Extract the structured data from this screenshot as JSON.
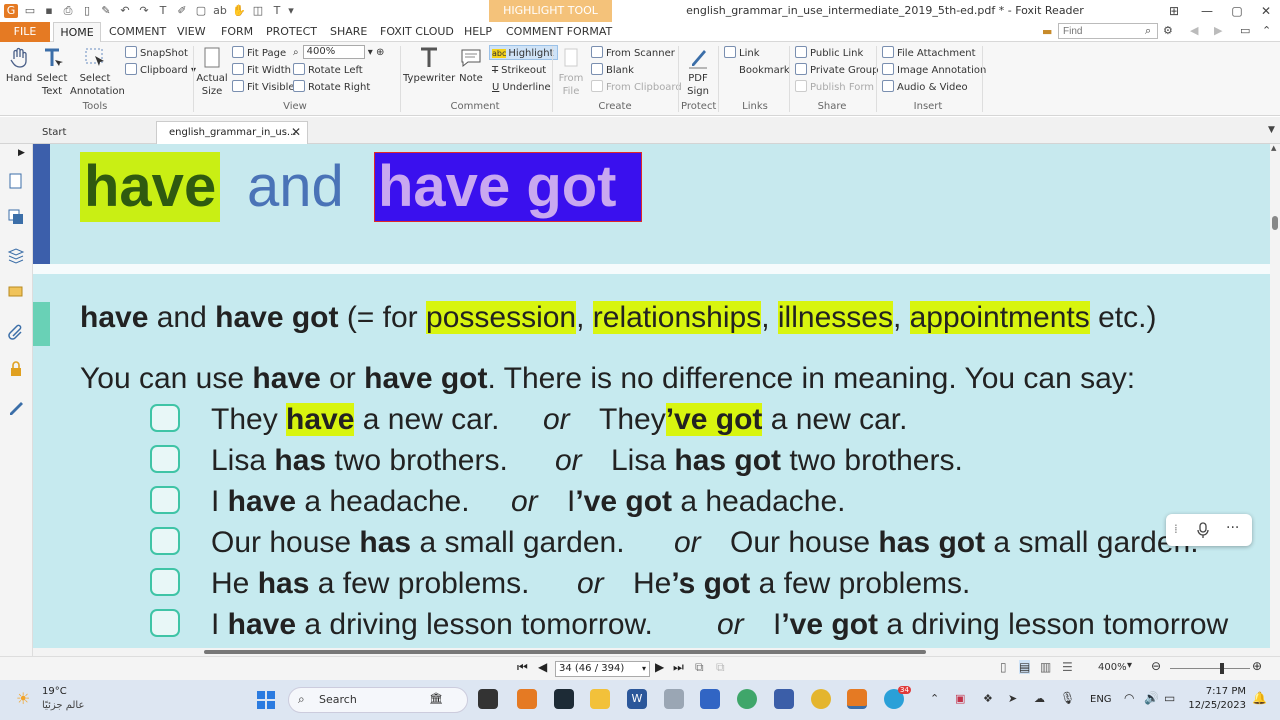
{
  "titlebar": {
    "context_tab": "HIGHLIGHT TOOL",
    "window_title": "english_grammar_in_use_intermediate_2019_5th-ed.pdf * - Foxit Reader"
  },
  "menu": {
    "items": [
      "FILE",
      "HOME",
      "COMMENT",
      "VIEW",
      "FORM",
      "PROTECT",
      "SHARE",
      "FOXIT CLOUD",
      "HELP",
      "COMMENT FORMAT"
    ],
    "find_placeholder": "Find"
  },
  "ribbon": {
    "tools": {
      "hand": "Hand",
      "select_text": "Select Text",
      "select_annotation": "Select Annotation",
      "snapshot": "SnapShot",
      "clipboard": "Clipboard",
      "group": "Tools"
    },
    "view": {
      "actual_size": "Actual Size",
      "fit_page": "Fit Page",
      "fit_width": "Fit Width",
      "fit_visible": "Fit Visible",
      "zoom": "400%",
      "rotate_left": "Rotate Left",
      "rotate_right": "Rotate Right",
      "group": "View"
    },
    "comment": {
      "typewriter": "Typewriter",
      "note": "Note",
      "highlight": "Highlight",
      "strikeout": "Strikeout",
      "underline": "Underline",
      "group": "Comment"
    },
    "create": {
      "from_file": "From File",
      "from_scanner": "From Scanner",
      "blank": "Blank",
      "from_clipboard": "From Clipboard",
      "group": "Create"
    },
    "protect": {
      "pdf_sign": "PDF Sign",
      "group": "Protect"
    },
    "links": {
      "link": "Link",
      "bookmark": "Bookmark",
      "group": "Links"
    },
    "share": {
      "public_link": "Public Link",
      "private_group": "Private Group",
      "publish_form": "Publish Form",
      "group": "Share"
    },
    "insert": {
      "file_attachment": "File Attachment",
      "image_annotation": "Image Annotation",
      "audio_video": "Audio & Video",
      "group": "Insert"
    }
  },
  "doc_tabs": {
    "start": "Start",
    "current": "english_grammar_in_us..."
  },
  "page": {
    "title": {
      "have": "have",
      "and": "and",
      "have_got": "have got"
    },
    "section": {
      "have": "have",
      "and": " and ",
      "have_got": "have got",
      "eq": " (= for ",
      "possession": "possession",
      "comma1": ", ",
      "relationships": "relationships",
      "comma2": ", ",
      "illnesses": "illnesses",
      "comma3": ", ",
      "appointments": "appointments",
      "etc": " etc.)"
    },
    "intro": {
      "p1": "You can use ",
      "have": "have",
      "p2": " or ",
      "have_got": "have got",
      "p3": ".  There is no difference in meaning.  You can say:"
    },
    "or": "or",
    "examples": [
      {
        "a1": "They ",
        "a2": "have",
        "a3": " a new car.",
        "b1": "They",
        "b2": "’ve got",
        "b3": " a new car."
      },
      {
        "a1": "Lisa ",
        "a2": "has",
        "a3": " two brothers.",
        "b1": "Lisa ",
        "b2": "has got",
        "b3": " two brothers."
      },
      {
        "a1": "I ",
        "a2": "have",
        "a3": " a headache.",
        "b1": "I",
        "b2": "’ve got",
        "b3": " a headache."
      },
      {
        "a1": "Our house ",
        "a2": "has",
        "a3": " a small garden.",
        "b1": "Our house ",
        "b2": "has got",
        "b3": " a small garden."
      },
      {
        "a1": "He ",
        "a2": "has",
        "a3": " a few problems.",
        "b1": "He",
        "b2": "’s got",
        "b3": " a few problems."
      },
      {
        "a1": "I ",
        "a2": "have",
        "a3": " a driving lesson tomorrow.",
        "b1": "I",
        "b2": "’ve got",
        "b3": " a driving lesson tomorrow"
      }
    ]
  },
  "status": {
    "page_indicator": "34 (46 / 394)",
    "zoom": "400%"
  },
  "taskbar": {
    "temperature": "19°C",
    "weather_sub": "عالم جزئيًا",
    "search": "Search",
    "lang": "ENG",
    "time": "7:17 PM",
    "date": "12/25/2023",
    "badge": "34"
  },
  "colors": {
    "accent": "#e57a23",
    "highlight_yellow": "#d8f50f",
    "highlight_blue": "#3a10ee",
    "page_bg": "#c6eaef"
  }
}
